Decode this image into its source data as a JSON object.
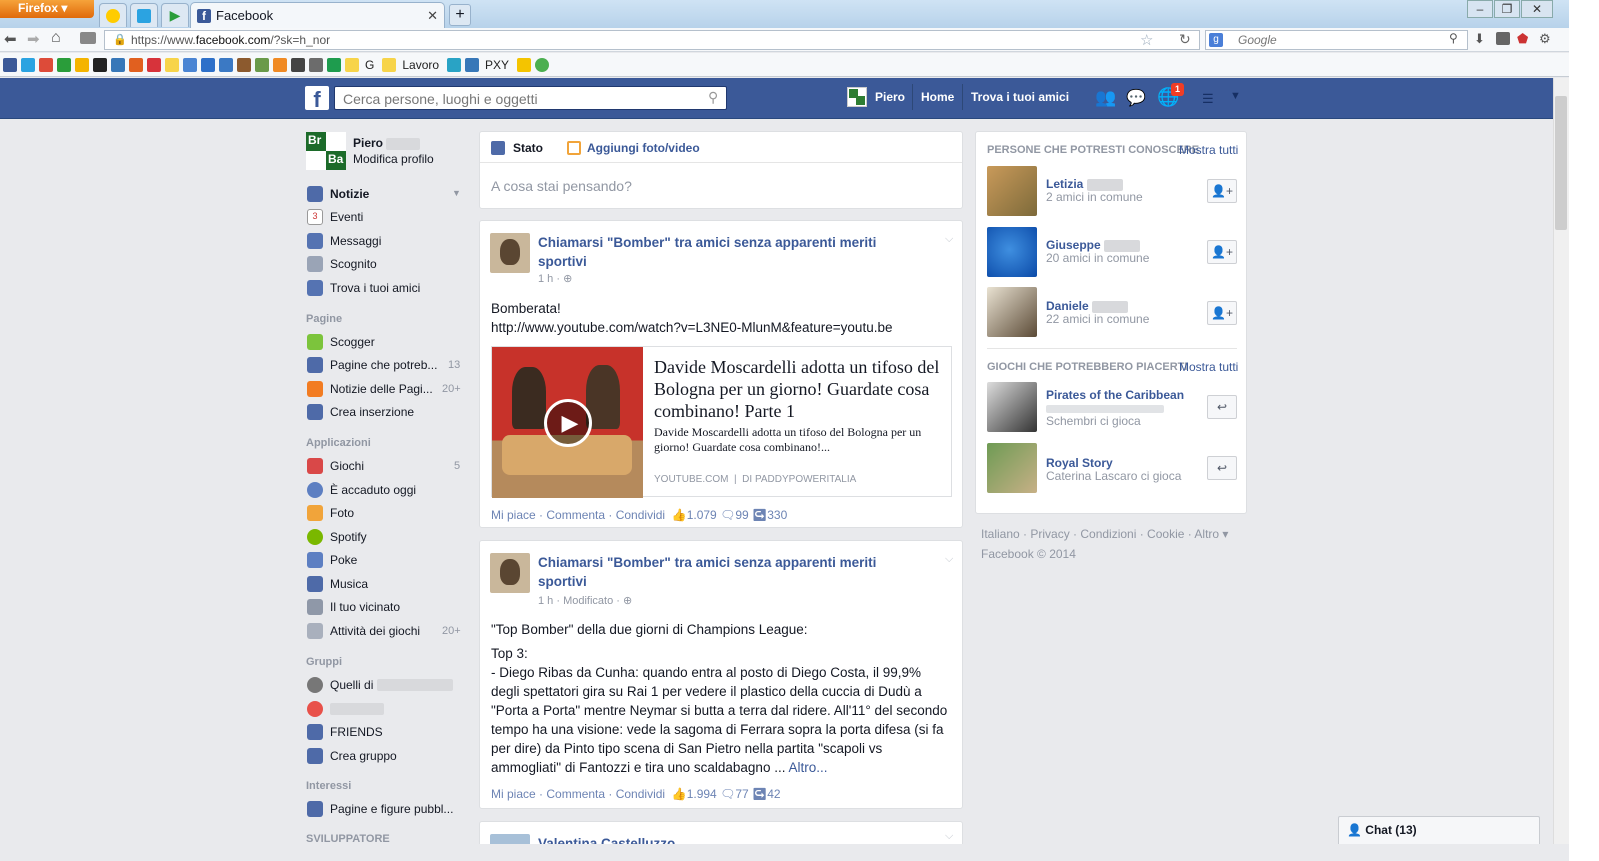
{
  "browser": {
    "firefox_label": "Firefox",
    "tab_title": "Facebook",
    "url_prefix": "https://www.",
    "url_domain": "facebook.com",
    "url_suffix": "/?sk=h_nor",
    "search_placeholder": "Google",
    "bookmarks": [
      "G",
      "Lavoro",
      "PXY"
    ]
  },
  "fb": {
    "search_placeholder": "Cerca persone, luoghi e oggetti",
    "nav_user": "Piero",
    "nav_home": "Home",
    "nav_find_friends": "Trova i tuoi amici",
    "notification_count": "1"
  },
  "profile": {
    "name": "Piero",
    "edit": "Modifica profilo"
  },
  "left_nav": {
    "main": [
      {
        "label": "Notizie",
        "bold": true
      },
      {
        "label": "Eventi"
      },
      {
        "label": "Messaggi"
      },
      {
        "label": "Scognito"
      },
      {
        "label": "Trova i tuoi amici"
      }
    ],
    "pages_header": "Pagine",
    "pages": [
      {
        "label": "Scogger",
        "count": ""
      },
      {
        "label": "Pagine che potreb...",
        "count": "13"
      },
      {
        "label": "Notizie delle Pagi...",
        "count": "20+"
      },
      {
        "label": "Crea inserzione",
        "count": ""
      }
    ],
    "apps_header": "Applicazioni",
    "apps": [
      {
        "label": "Giochi",
        "count": "5"
      },
      {
        "label": "È accaduto oggi",
        "count": ""
      },
      {
        "label": "Foto",
        "count": ""
      },
      {
        "label": "Spotify",
        "count": ""
      },
      {
        "label": "Poke",
        "count": ""
      },
      {
        "label": "Musica",
        "count": ""
      },
      {
        "label": "Il tuo vicinato",
        "count": ""
      },
      {
        "label": "Attività dei giochi",
        "count": "20+"
      }
    ],
    "groups_header": "Gruppi",
    "groups": [
      {
        "label": "Quelli di"
      },
      {
        "label": ""
      },
      {
        "label": "FRIENDS"
      },
      {
        "label": "Crea gruppo"
      }
    ],
    "interests_header": "Interessi",
    "interests": [
      {
        "label": "Pagine e figure pubbl..."
      }
    ],
    "dev_header": "SVILUPPATORE"
  },
  "composer": {
    "tab_status": "Stato",
    "tab_photo": "Aggiungi foto/video",
    "placeholder": "A cosa stai pensando?"
  },
  "posts": [
    {
      "author": "Chiamarsi \"Bomber\" tra amici senza apparenti meriti sportivi",
      "time": "1 h · ",
      "text": "Bomberata!",
      "link": "http://www.youtube.com/watch?v=L3NE0-MlunM&feature=youtu.be",
      "preview_title": "Davide Moscardelli adotta un tifoso del Bologna per un giorno! Guardate cosa combinano! Parte 1",
      "preview_desc": "Davide Moscardelli adotta un tifoso del Bologna per un giorno! Guardate cosa combinano!...",
      "preview_source": "YOUTUBE.COM",
      "preview_by": "DI PADDYPOWERITALIA",
      "like": "Mi piace",
      "comment": "Commenta",
      "share": "Condividi",
      "likes": "1.079",
      "comments": "99",
      "shares": "330"
    },
    {
      "author": "Chiamarsi \"Bomber\" tra amici senza apparenti meriti sportivi",
      "time": "1 h · Modificato · ",
      "line1": "\"Top Bomber\" della due giorni di Champions League:",
      "line2": "Top 3:",
      "body": "- Diego Ribas da Cunha: quando entra al posto di Diego Costa, il 99,9% degli spettatori gira su Rai 1 per vedere il plastico della cuccia di Dudù a \"Porta a Porta\" mentre Neymar si butta a terra dal ridere. All'11° del secondo tempo ha una visione: vede la sagoma di Ferrara sopra la porta difesa (si fa per dire) da Pinto tipo scena di San Pietro nella partita \"scapoli vs ammogliati\" di Fantozzi e tira uno scaldabagno ...",
      "more": "Altro...",
      "like": "Mi piace",
      "comment": "Commenta",
      "share": "Condividi",
      "likes": "1.994",
      "comments": "77",
      "shares": "42"
    },
    {
      "author": "Valentina Castelluzzo"
    }
  ],
  "right": {
    "people_header": "PERSONE CHE POTRESTI CONOSCERE",
    "show_all": "Mostra tutti",
    "people": [
      {
        "name": "Letizia",
        "mutual": "2 amici in comune"
      },
      {
        "name": "Giuseppe",
        "mutual": "20 amici in comune"
      },
      {
        "name": "Daniele",
        "mutual": "22 amici in comune"
      }
    ],
    "games_header": "GIOCHI CHE POTREBBERO PIACERTI",
    "games_show_all": "Mostra tutti",
    "games": [
      {
        "name": "Pirates of the Caribbean",
        "sub": "Schembri ci gioca"
      },
      {
        "name": "Royal Story",
        "sub": "Caterina Lascaro ci gioca"
      }
    ],
    "footer_links": "Italiano · Privacy · Condizioni · Cookie · Altro ▾",
    "footer_copy": "Facebook © 2014"
  },
  "chat": {
    "label": "Chat (13)"
  }
}
